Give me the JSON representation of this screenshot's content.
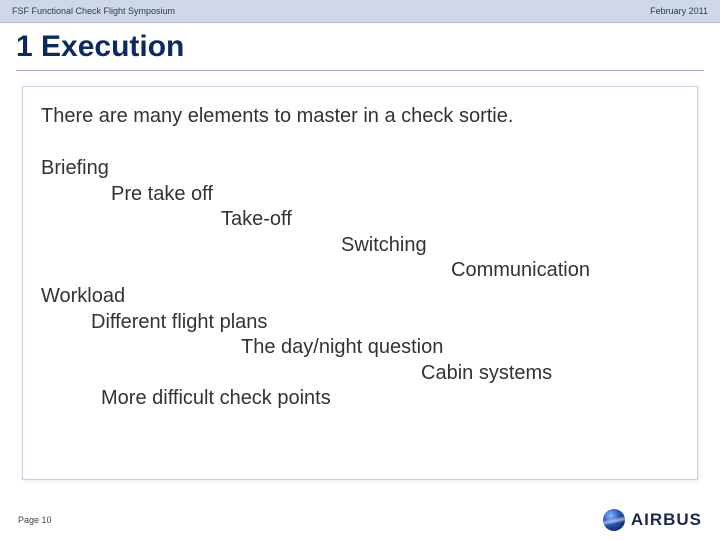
{
  "header": {
    "left": "FSF Functional Check Flight Symposium",
    "right": "February 2011"
  },
  "title": "1  Execution",
  "lead": "There are many elements to master in a check sortie.",
  "group1": [
    "Briefing",
    "Pre take off",
    "Take-off",
    "Switching",
    "Communication"
  ],
  "group2": [
    "Workload",
    "Different flight plans",
    "The day/night question",
    "Cabin systems",
    "More difficult check points"
  ],
  "footer": {
    "page": "Page 10",
    "brand": "AIRBUS"
  }
}
